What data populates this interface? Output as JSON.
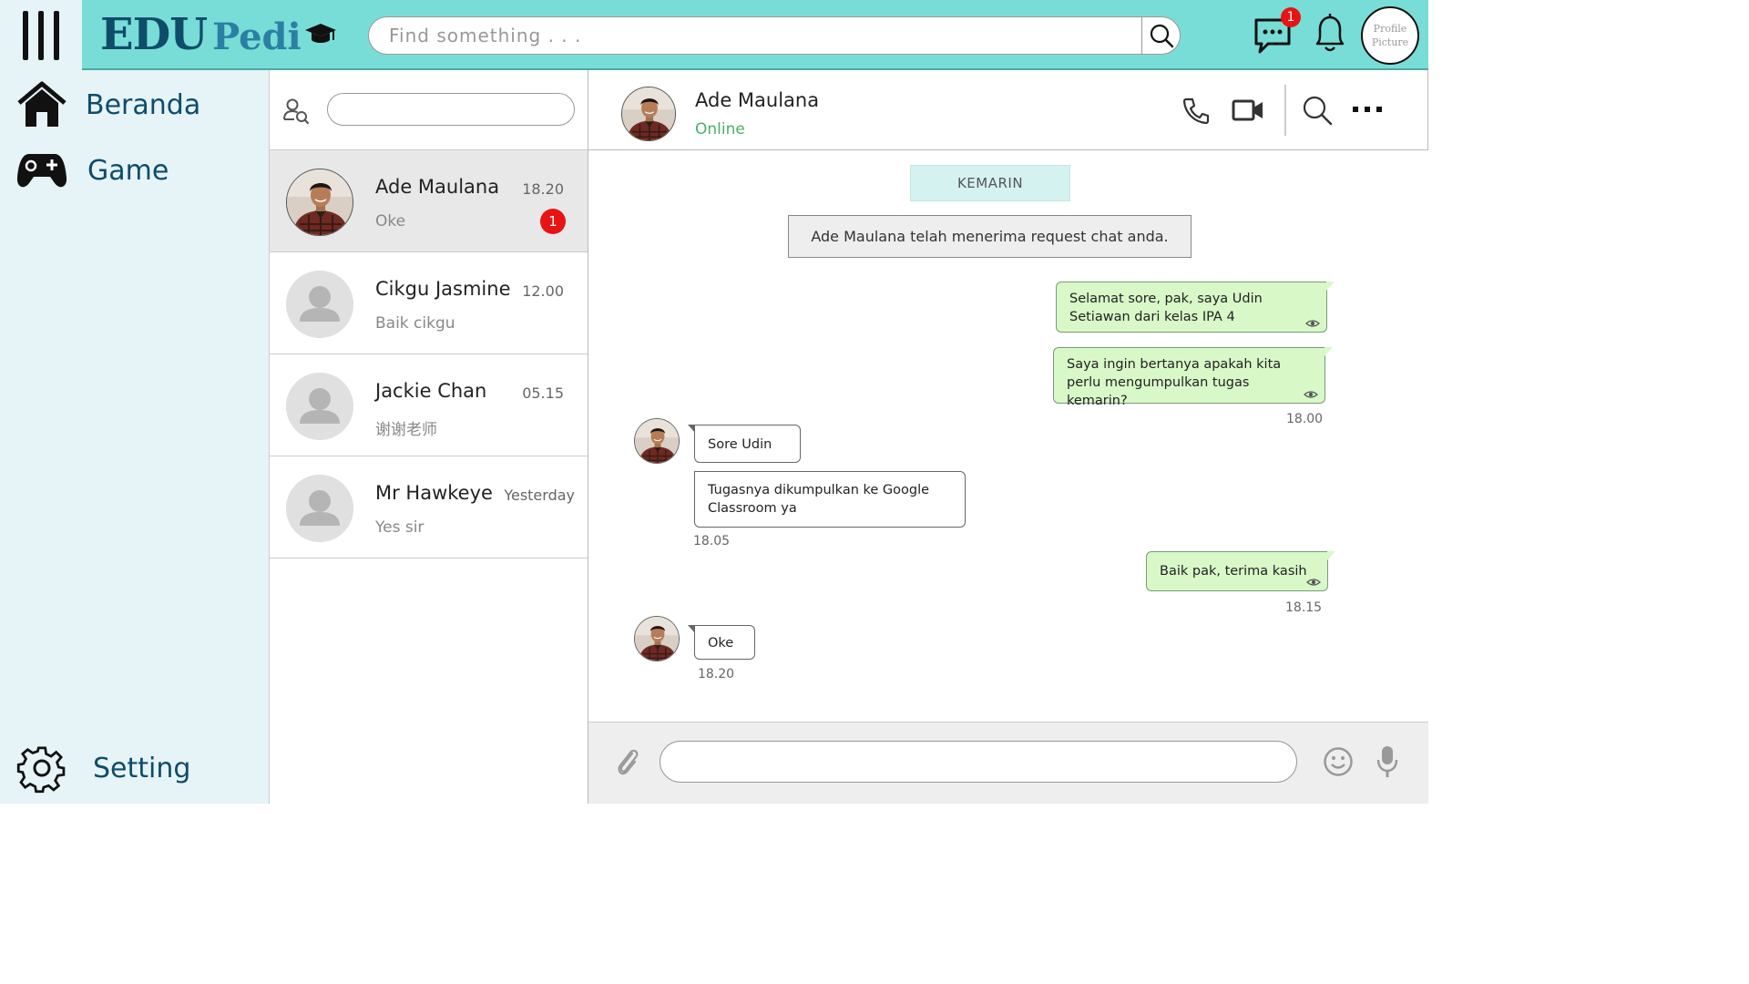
{
  "app": {
    "logo_edu": "EDU",
    "logo_pedi": "Pedi",
    "search_placeholder": "Find something . . .",
    "message_badge": "1",
    "profile_text": "Profile Picture",
    "accent": "#78ddd6"
  },
  "sidebar": {
    "items": [
      {
        "label": "Beranda",
        "icon": "home-icon"
      },
      {
        "label": "Game",
        "icon": "gamepad-icon"
      },
      {
        "label": "Setting",
        "icon": "gear-icon"
      }
    ]
  },
  "chat_list": {
    "conversations": [
      {
        "name": "Ade Maulana",
        "time": "18.20",
        "preview": "Oke",
        "unread": "1",
        "active": true
      },
      {
        "name": "Cikgu Jasmine",
        "time": "12.00",
        "preview": "Baik cikgu"
      },
      {
        "name": "Jackie Chan",
        "time": "05.15",
        "preview": "谢谢老师"
      },
      {
        "name": "Mr Hawkeye",
        "time": "Yesterday",
        "preview": "Yes sir"
      }
    ]
  },
  "chat": {
    "contact_name": "Ade Maulana",
    "contact_status": "Online",
    "day_label": "KEMARIN",
    "system_message": "Ade Maulana telah menerima request chat anda.",
    "messages": [
      {
        "dir": "out",
        "text": "Selamat sore, pak, saya Udin Setiawan dari kelas IPA 4"
      },
      {
        "dir": "out",
        "text": "Saya ingin bertanya apakah kita perlu mengumpulkan tugas kemarin?",
        "time": "18.00"
      },
      {
        "dir": "in",
        "text": "Sore Udin"
      },
      {
        "dir": "in",
        "text": "Tugasnya dikumpulkan ke Google Classroom ya",
        "time": "18.05"
      },
      {
        "dir": "out",
        "text": "Baik pak, terima kasih",
        "time": "18.15"
      },
      {
        "dir": "in",
        "text": "Oke",
        "time": "18.20"
      }
    ]
  }
}
